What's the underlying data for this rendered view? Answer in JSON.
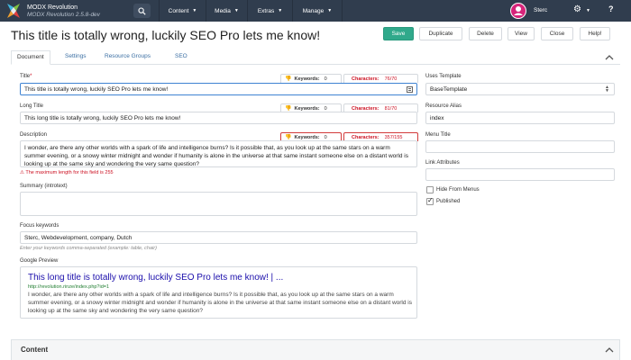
{
  "header": {
    "app_name": "MODX Revolution",
    "version": "MODX Revolution 2.5.8-dev",
    "menu": [
      {
        "label": "Content"
      },
      {
        "label": "Media"
      },
      {
        "label": "Extras"
      },
      {
        "label": "Manage"
      }
    ],
    "user_name": "Sterc",
    "help_label": "?",
    "icons": [
      "modx-logo",
      "search-icon",
      "caret-down-icon",
      "gear-icon",
      "help-icon"
    ]
  },
  "page": {
    "title": "This title is totally wrong, luckily SEO Pro lets me know!"
  },
  "actions": {
    "save": "Save",
    "duplicate": "Duplicate",
    "delete": "Delete",
    "view": "View",
    "close": "Close",
    "help": "Help!"
  },
  "tabs": [
    {
      "label": "Document",
      "active": true
    },
    {
      "label": "Settings"
    },
    {
      "label": "Resource Groups"
    },
    {
      "label": "SEO"
    }
  ],
  "form": {
    "title": {
      "label": "Title",
      "required_mark": "*",
      "value": "This title is totally wrong, luckily SEO Pro lets me know!",
      "keywords_label": "Keywords:",
      "keywords_count": "0",
      "characters_label": "Characters:",
      "characters_count": "76/70"
    },
    "longtitle": {
      "label": "Long Title",
      "value": "This long title is totally wrong, luckily SEO Pro lets me know!",
      "keywords_label": "Keywords:",
      "keywords_count": "0",
      "characters_label": "Characters:",
      "characters_count": "81/70"
    },
    "description": {
      "label": "Description",
      "value": "I wonder, are there any other worlds with a spark of life and intelligence burns? Is it possible that, as you look up at the same stars on a warm summer evening, or a snowy winter midnight and wonder if humanity is alone in the universe at that same instant someone else on a distant world is looking up at the same sky and wondering the very same question?",
      "keywords_label": "Keywords:",
      "keywords_count": "0",
      "characters_label": "Characters:",
      "characters_count": "357/155",
      "error": "The maximum length for this field is 255"
    },
    "summary": {
      "label": "Summary (introtext)",
      "value": ""
    },
    "focus_keywords": {
      "label": "Focus keywords",
      "value": "Sterc, Webdevelopment, company, Dutch",
      "hint": "Enter your keywords comma-separated (example: table, chair)"
    },
    "google_preview": {
      "label": "Google Preview",
      "title": "This long title is totally wrong, luckily SEO Pro lets me know! | ...",
      "url": "http://revolution.rinze/index.php?id=1",
      "description": "I wonder, are there any other worlds with a spark of life and intelligence burns? Is it possible that, as you look up at the same stars on a warm summer evening, or a snowy winter midnight and wonder if humanity is alone in the universe at that same instant someone else on a distant world is looking up at the same sky and wondering the very same question?"
    }
  },
  "sidebar": {
    "template": {
      "label": "Uses Template",
      "value": "BaseTemplate"
    },
    "alias": {
      "label": "Resource Alias",
      "value": "index"
    },
    "menu_title": {
      "label": "Menu Title",
      "value": ""
    },
    "link_attributes": {
      "label": "Link Attributes",
      "value": ""
    },
    "hide_from_menus": {
      "label": "Hide From Menus",
      "checked": false
    },
    "published": {
      "label": "Published",
      "checked": true
    }
  },
  "content_panel": {
    "title": "Content"
  },
  "colors": {
    "topbar": "#303d4e",
    "save": "#30a98b",
    "link": "#3b6fa3",
    "error": "#d23a3a",
    "google_title": "#1a0dab",
    "google_url": "#1f7d2f"
  }
}
